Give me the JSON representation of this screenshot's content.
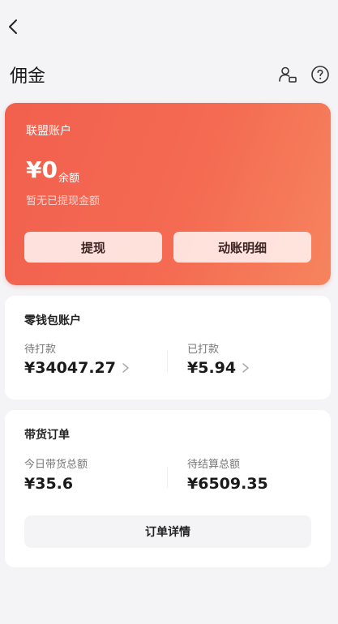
{
  "header": {
    "title": "佣金",
    "icons": [
      "back-arrow-icon",
      "person-card-icon",
      "help-icon"
    ]
  },
  "alliance_account": {
    "label": "联盟账户",
    "amount": "¥0",
    "balance_label": "余额",
    "note": "暂无已提现金额",
    "withdraw_label": "提现",
    "details_label": "动账明细",
    "accent_color": "#f2604e"
  },
  "wallet": {
    "title": "零钱包账户",
    "pending_label": "待打款",
    "pending_value": "¥34047.27",
    "paid_label": "已打款",
    "paid_value": "¥5.94"
  },
  "orders": {
    "title": "带货订单",
    "today_label": "今日带货总额",
    "today_value": "¥35.6",
    "unsettled_label": "待结算总额",
    "unsettled_value": "¥6509.35",
    "details_button": "订单详情"
  }
}
